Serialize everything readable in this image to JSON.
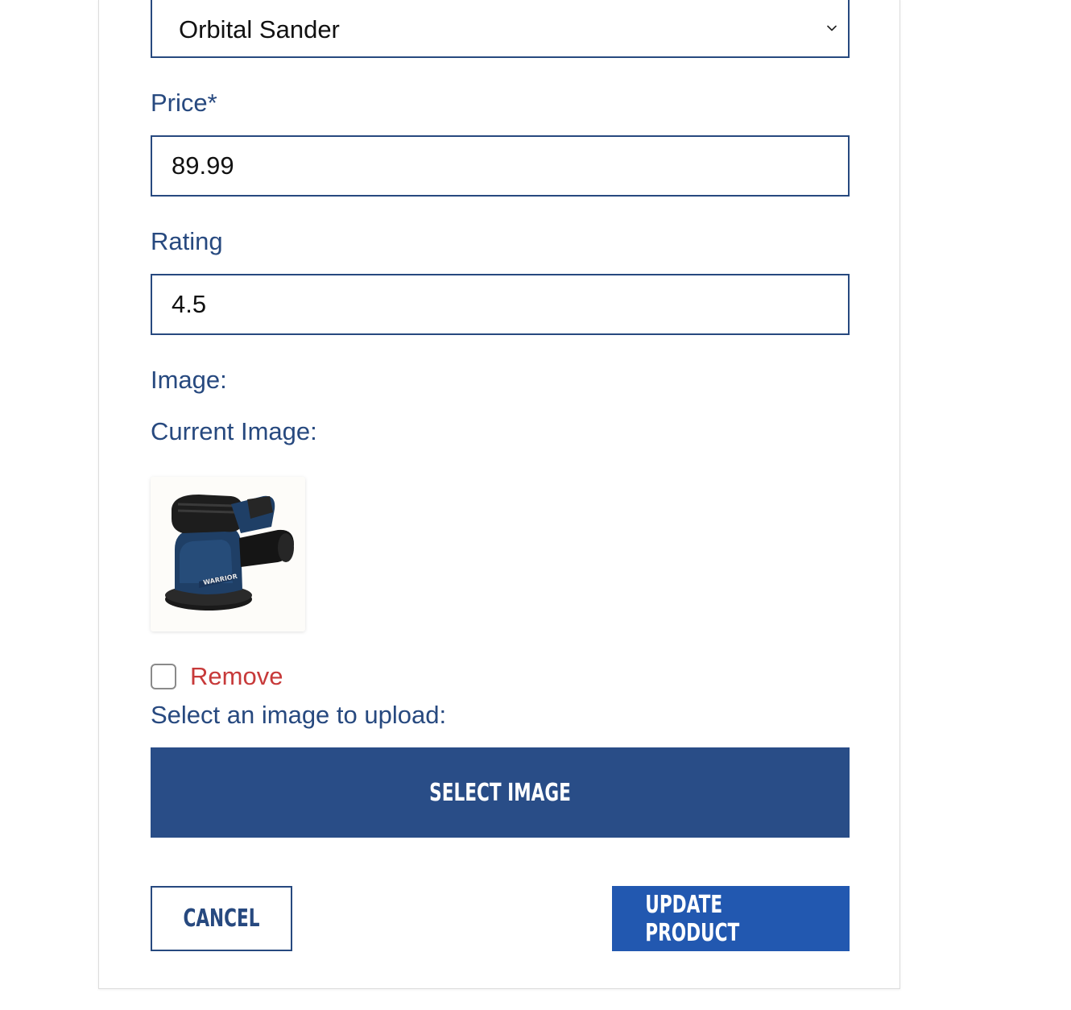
{
  "form": {
    "category_select": {
      "selected_value": "Orbital Sander"
    },
    "price": {
      "label": "Price*",
      "value": "89.99"
    },
    "rating": {
      "label": "Rating",
      "value": "4.5"
    },
    "image": {
      "label": "Image:",
      "current_label": "Current Image:",
      "thumbnail_brand_text": "WARRIOR",
      "remove_label": "Remove",
      "remove_checked": false,
      "upload_label": "Select an image to upload:",
      "select_button": "SELECT IMAGE"
    },
    "actions": {
      "cancel": "CANCEL",
      "update": "UPDATE PRODUCT"
    }
  },
  "colors": {
    "primary_text": "#27497f",
    "select_button_bg": "#294d87",
    "update_button_bg": "#2258b0",
    "remove_text": "#c73a3a"
  },
  "icons": {
    "dropdown": "chevron-down-icon"
  }
}
